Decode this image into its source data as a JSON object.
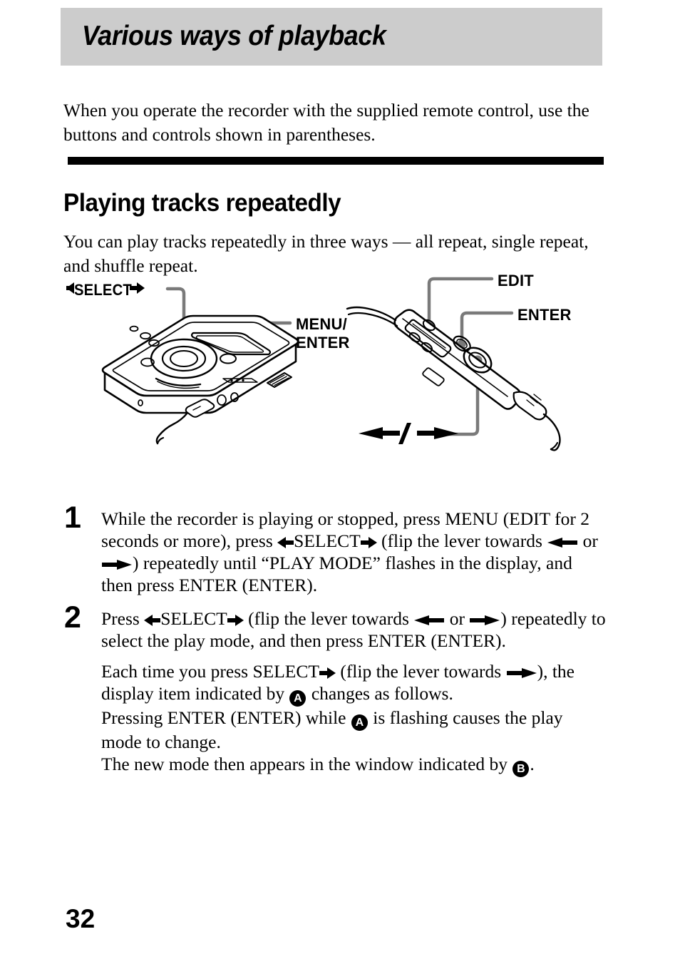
{
  "page": {
    "number": "32",
    "banner_title": "Various ways of playback",
    "banner_bg": "#cccccc",
    "intro": "When you operate the recorder with the supplied remote control, use the buttons and controls shown in parentheses."
  },
  "section": {
    "heading": "Playing tracks repeatedly",
    "lead": "You can play tracks repeatedly in three ways — all repeat, single repeat, and shuffle repeat."
  },
  "figure": {
    "labels": {
      "select": "SELECT",
      "menu_enter_line1": "MENU/",
      "menu_enter_line2": "ENTER",
      "edit": "EDIT",
      "enter": "ENTER"
    },
    "callout_line_color": "#7a7a7a",
    "artwork": {
      "recorder_alt": "md-recorder-line-art",
      "remote_alt": "remote-control-line-art"
    }
  },
  "steps": [
    {
      "number": "1",
      "text_a": "While the recorder is playing or stopped, press MENU (EDIT for 2 seconds or more), press ",
      "select_word": "SELECT",
      "text_b": " (flip the lever towards ",
      "text_or": " or ",
      "text_c": ") repeatedly until “PLAY MODE” flashes in the display, and then press ENTER (ENTER)."
    },
    {
      "number": "2",
      "text_a": "Press ",
      "select_word": "SELECT",
      "text_b": " (flip the lever towards ",
      "text_or": " or ",
      "text_c": ") repeatedly to select the play mode, and then press ENTER (ENTER).",
      "paragraphs": {
        "p2_a": "Each time you press SELECT",
        "p2_b": " (flip the lever towards ",
        "p2_c": "), the display item indicated by ",
        "marker_a": "A",
        "p2_d": " changes as follows.",
        "p3_a": "Pressing ENTER (ENTER) while ",
        "p3_b": " is flashing causes the play mode to change.",
        "p4_a": "The new mode then appears in the window indicated by ",
        "marker_b": "B",
        "p4_b": "."
      }
    }
  ]
}
